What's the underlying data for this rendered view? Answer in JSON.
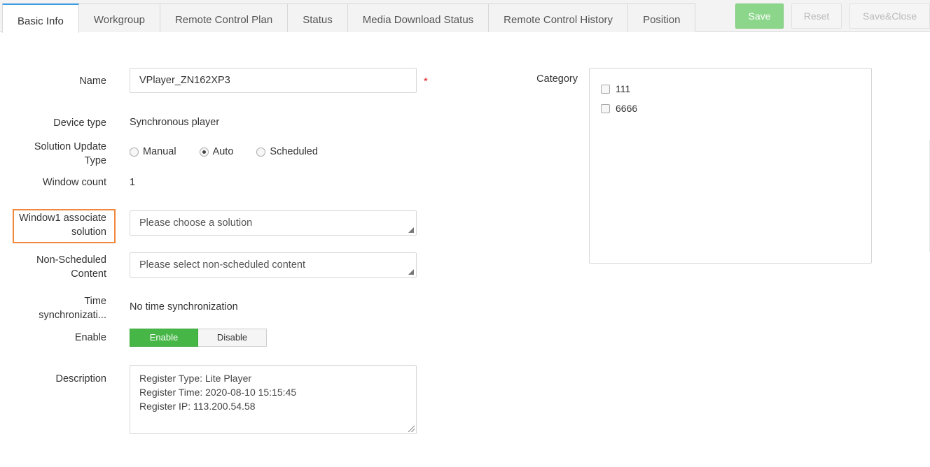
{
  "tabs": [
    {
      "label": "Basic Info",
      "active": true
    },
    {
      "label": "Workgroup"
    },
    {
      "label": "Remote Control Plan"
    },
    {
      "label": "Status"
    },
    {
      "label": "Media Download Status"
    },
    {
      "label": "Remote Control History"
    },
    {
      "label": "Position"
    }
  ],
  "actions": {
    "save": "Save",
    "reset": "Reset",
    "save_close": "Save&Close"
  },
  "form": {
    "name": {
      "label": "Name",
      "value": "VPlayer_ZN162XP3",
      "required_mark": "*"
    },
    "device_type": {
      "label": "Device type",
      "value": "Synchronous player"
    },
    "solution_update_type": {
      "label_line1": "Solution Update",
      "label_line2": "Type",
      "options": [
        "Manual",
        "Auto",
        "Scheduled"
      ],
      "selected": "Auto"
    },
    "window_count": {
      "label": "Window count",
      "value": "1"
    },
    "window1_solution": {
      "label_line1": "Window1 associate",
      "label_line2": "solution",
      "placeholder": "Please choose a solution"
    },
    "non_scheduled": {
      "label_line1": "Non-Scheduled",
      "label_line2": "Content",
      "placeholder": "Please select non-scheduled content"
    },
    "time_sync": {
      "label_line1": "Time",
      "label_line2": "synchronizati...",
      "value": "No time synchronization"
    },
    "enable": {
      "label": "Enable",
      "on_label": "Enable",
      "off_label": "Disable",
      "state": "Enable"
    },
    "description": {
      "label": "Description",
      "lines": [
        "Register Type: Lite Player",
        "Register Time: 2020-08-10 15:15:45",
        "Register IP: 113.200.54.58"
      ]
    }
  },
  "category": {
    "label": "Category",
    "items": [
      "111",
      "6666"
    ]
  },
  "colors": {
    "accent_tab": "#3a9be0",
    "save_button": "#8cd68c",
    "enable_on": "#46b646",
    "required": "#e02020",
    "highlight": "#f0883e"
  }
}
